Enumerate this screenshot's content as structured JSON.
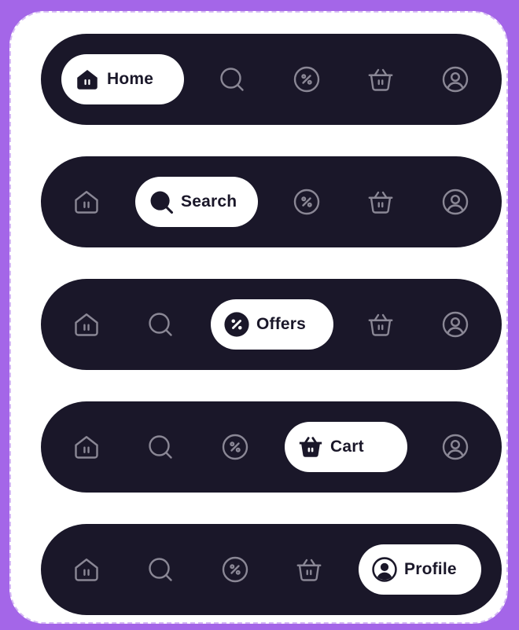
{
  "colors": {
    "background": "#a466e8",
    "card": "#ffffff",
    "bar": "#1a1729",
    "inactive_icon": "#8a8795",
    "active_pill": "#ffffff",
    "active_text": "#1a1729"
  },
  "nav_bars": [
    {
      "active": "home",
      "tabs": [
        {
          "id": "home",
          "label": "Home",
          "icon": "home-icon"
        },
        {
          "id": "search",
          "label": "Search",
          "icon": "search-icon"
        },
        {
          "id": "offers",
          "label": "Offers",
          "icon": "percent-icon"
        },
        {
          "id": "cart",
          "label": "Cart",
          "icon": "basket-icon"
        },
        {
          "id": "profile",
          "label": "Profile",
          "icon": "user-icon"
        }
      ]
    },
    {
      "active": "search",
      "tabs": [
        {
          "id": "home",
          "label": "Home",
          "icon": "home-icon"
        },
        {
          "id": "search",
          "label": "Search",
          "icon": "search-icon"
        },
        {
          "id": "offers",
          "label": "Offers",
          "icon": "percent-icon"
        },
        {
          "id": "cart",
          "label": "Cart",
          "icon": "basket-icon"
        },
        {
          "id": "profile",
          "label": "Profile",
          "icon": "user-icon"
        }
      ]
    },
    {
      "active": "offers",
      "tabs": [
        {
          "id": "home",
          "label": "Home",
          "icon": "home-icon"
        },
        {
          "id": "search",
          "label": "Search",
          "icon": "search-icon"
        },
        {
          "id": "offers",
          "label": "Offers",
          "icon": "percent-icon"
        },
        {
          "id": "cart",
          "label": "Cart",
          "icon": "basket-icon"
        },
        {
          "id": "profile",
          "label": "Profile",
          "icon": "user-icon"
        }
      ]
    },
    {
      "active": "cart",
      "tabs": [
        {
          "id": "home",
          "label": "Home",
          "icon": "home-icon"
        },
        {
          "id": "search",
          "label": "Search",
          "icon": "search-icon"
        },
        {
          "id": "offers",
          "label": "Offers",
          "icon": "percent-icon"
        },
        {
          "id": "cart",
          "label": "Cart",
          "icon": "basket-icon"
        },
        {
          "id": "profile",
          "label": "Profile",
          "icon": "user-icon"
        }
      ]
    },
    {
      "active": "profile",
      "tabs": [
        {
          "id": "home",
          "label": "Home",
          "icon": "home-icon"
        },
        {
          "id": "search",
          "label": "Search",
          "icon": "search-icon"
        },
        {
          "id": "offers",
          "label": "Offers",
          "icon": "percent-icon"
        },
        {
          "id": "cart",
          "label": "Cart",
          "icon": "basket-icon"
        },
        {
          "id": "profile",
          "label": "Profile",
          "icon": "user-icon"
        }
      ]
    }
  ]
}
